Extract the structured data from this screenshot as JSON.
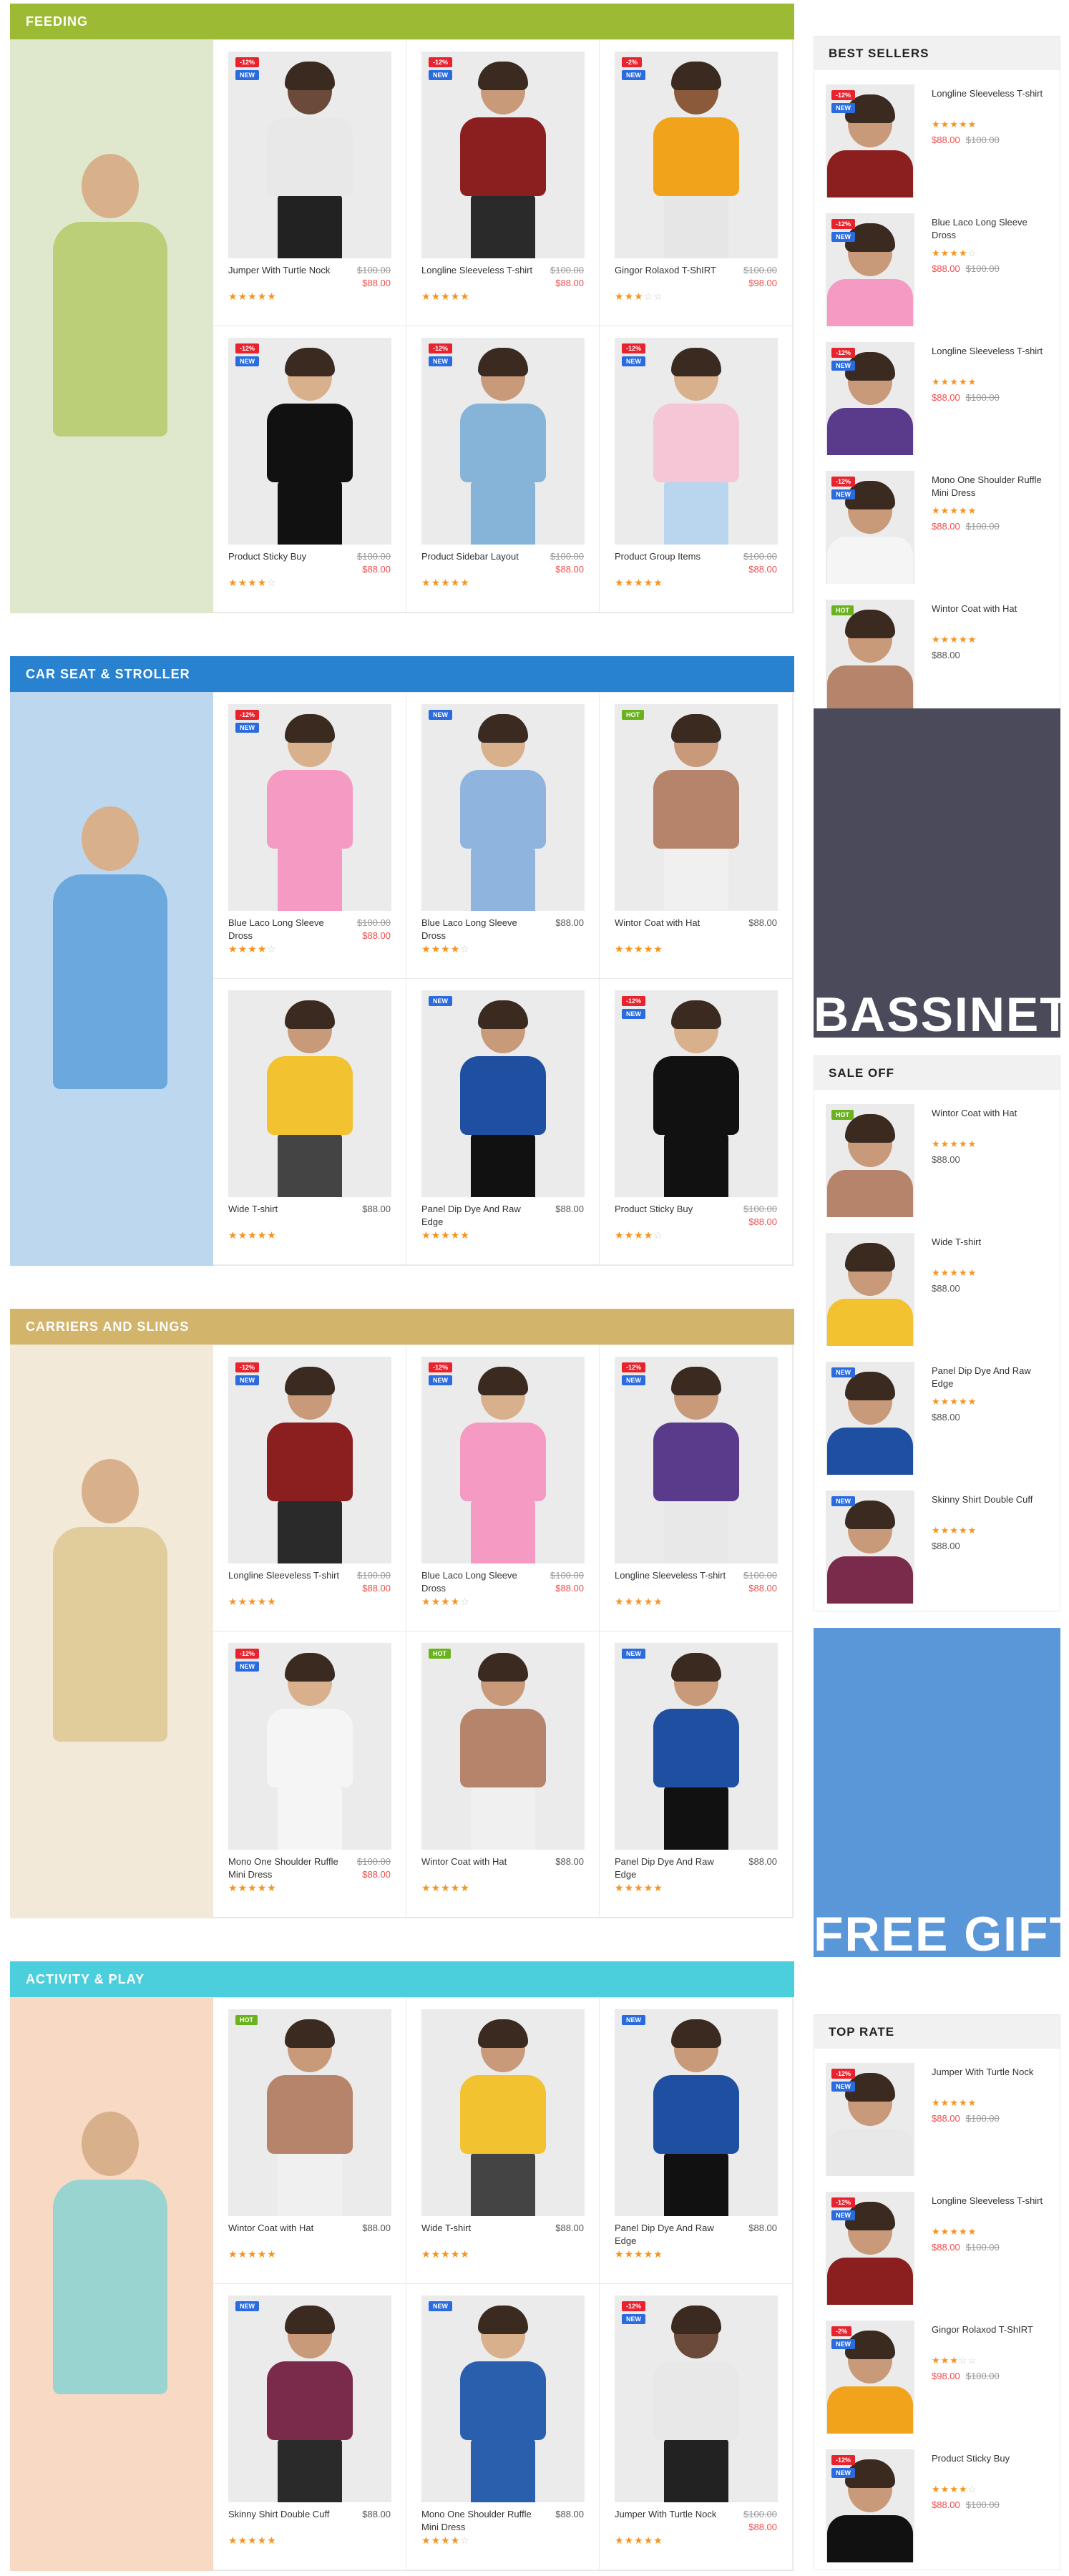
{
  "sections": [
    {
      "title": "FEEDING",
      "color": "#9cba33",
      "banner_bg": "#dfe8cd",
      "products": [
        {
          "name": "Jumper With Turtle Nock",
          "old": "$100.00",
          "price": "$88.00",
          "stars": 5,
          "badges": [
            "-12%",
            "NEW"
          ],
          "top": "#e8e8e8",
          "bottom": "#222222",
          "skin": "#6b4a3a"
        },
        {
          "name": "Longline Sleeveless T-shirt",
          "old": "$100.00",
          "price": "$88.00",
          "stars": 5,
          "badges": [
            "-12%",
            "NEW"
          ],
          "top": "#8b1f1f",
          "bottom": "#2a2a2a",
          "skin": "#c89a7a"
        },
        {
          "name": "Gingor Rolaxod T-ShIRT",
          "old": "$100.00",
          "price": "$98.00",
          "stars": 3,
          "badges": [
            "-2%",
            "NEW"
          ],
          "top": "#f2a31c",
          "bottom": "#e6e6e6",
          "skin": "#8a5a3a"
        },
        {
          "name": "Product Sticky Buy",
          "old": "$100.00",
          "price": "$88.00",
          "stars": 4,
          "badges": [
            "-12%",
            "NEW"
          ],
          "top": "#111111",
          "bottom": "#111111",
          "skin": "#d9b08c"
        },
        {
          "name": "Product Sidebar Layout",
          "old": "$100.00",
          "price": "$88.00",
          "stars": 5,
          "badges": [
            "-12%",
            "NEW"
          ],
          "top": "#86b4d8",
          "bottom": "#86b4d8",
          "skin": "#c89a7a"
        },
        {
          "name": "Product Group Items",
          "old": "$100.00",
          "price": "$88.00",
          "stars": 5,
          "badges": [
            "-12%",
            "NEW"
          ],
          "top": "#f5c6d6",
          "bottom": "#b9d6ee",
          "skin": "#d9b08c"
        }
      ]
    },
    {
      "title": "CAR SEAT & STROLLER",
      "color": "#2882d0",
      "banner_bg": "#bdd7ee",
      "products": [
        {
          "name": "Blue Laco Long Sleeve Dross",
          "old": "$100.00",
          "price": "$88.00",
          "stars": 4,
          "badges": [
            "-12%",
            "NEW"
          ],
          "top": "#f49ac3",
          "bottom": "#f49ac3",
          "skin": "#d9b08c"
        },
        {
          "name": "Blue Laco Long Sleeve Dross",
          "old": "",
          "price": "$88.00",
          "stars": 4,
          "badges": [
            "NEW"
          ],
          "top": "#8fb4dd",
          "bottom": "#8fb4dd",
          "skin": "#d9b08c"
        },
        {
          "name": "Wintor Coat with Hat",
          "old": "",
          "price": "$88.00",
          "stars": 5,
          "badges": [
            "HOT"
          ],
          "top": "#b5846a",
          "bottom": "#f0f0f0",
          "skin": "#c89a7a"
        },
        {
          "name": "Wide T-shirt",
          "old": "",
          "price": "$88.00",
          "stars": 5,
          "badges": [],
          "top": "#f2c230",
          "bottom": "#444444",
          "skin": "#c89a7a"
        },
        {
          "name": "Panel Dip Dye And Raw Edge",
          "old": "",
          "price": "$88.00",
          "stars": 5,
          "badges": [
            "NEW"
          ],
          "top": "#1f4fa0",
          "bottom": "#111111",
          "skin": "#c89a7a"
        },
        {
          "name": "Product Sticky Buy",
          "old": "$100.00",
          "price": "$88.00",
          "stars": 4,
          "badges": [
            "-12%",
            "NEW"
          ],
          "top": "#111111",
          "bottom": "#111111",
          "skin": "#d9b08c"
        }
      ]
    },
    {
      "title": "CARRIERS AND SLINGS",
      "color": "#d2b46a",
      "banner_bg": "#f3e9d8",
      "products": [
        {
          "name": "Longline Sleeveless T-shirt",
          "old": "$100.00",
          "price": "$88.00",
          "stars": 5,
          "badges": [
            "-12%",
            "NEW"
          ],
          "top": "#8b1f1f",
          "bottom": "#2a2a2a",
          "skin": "#c89a7a"
        },
        {
          "name": "Blue Laco Long Sleeve Dross",
          "old": "$100.00",
          "price": "$88.00",
          "stars": 4,
          "badges": [
            "-12%",
            "NEW"
          ],
          "top": "#f49ac3",
          "bottom": "#f49ac3",
          "skin": "#d9b08c"
        },
        {
          "name": "Longline Sleeveless T-shirt",
          "old": "$100.00",
          "price": "$88.00",
          "stars": 5,
          "badges": [
            "-12%",
            "NEW"
          ],
          "top": "#5a3a8a",
          "bottom": "#e8e8e8",
          "skin": "#c89a7a"
        },
        {
          "name": "Mono One Shoulder Ruffle Mini Dress",
          "old": "$100.00",
          "price": "$88.00",
          "stars": 5,
          "badges": [
            "-12%",
            "NEW"
          ],
          "top": "#f5f5f5",
          "bottom": "#f5f5f5",
          "skin": "#d9b08c"
        },
        {
          "name": "Wintor Coat with Hat",
          "old": "",
          "price": "$88.00",
          "stars": 5,
          "badges": [
            "HOT"
          ],
          "top": "#b5846a",
          "bottom": "#f0f0f0",
          "skin": "#c89a7a"
        },
        {
          "name": "Panel Dip Dye And Raw Edge",
          "old": "",
          "price": "$88.00",
          "stars": 5,
          "badges": [
            "NEW"
          ],
          "top": "#1f4fa0",
          "bottom": "#111111",
          "skin": "#c89a7a"
        }
      ]
    },
    {
      "title": "ACTIVITY & PLAY",
      "color": "#4ccfdc",
      "banner_bg": "#f7d9c4",
      "products": [
        {
          "name": "Wintor Coat with Hat",
          "old": "",
          "price": "$88.00",
          "stars": 5,
          "badges": [
            "HOT"
          ],
          "top": "#b5846a",
          "bottom": "#f0f0f0",
          "skin": "#c89a7a"
        },
        {
          "name": "Wide T-shirt",
          "old": "",
          "price": "$88.00",
          "stars": 5,
          "badges": [],
          "top": "#f2c230",
          "bottom": "#444444",
          "skin": "#c89a7a"
        },
        {
          "name": "Panel Dip Dye And Raw Edge",
          "old": "",
          "price": "$88.00",
          "stars": 5,
          "badges": [
            "NEW"
          ],
          "top": "#1f4fa0",
          "bottom": "#111111",
          "skin": "#c89a7a"
        },
        {
          "name": "Skinny Shirt Double Cuff",
          "old": "",
          "price": "$88.00",
          "stars": 5,
          "badges": [
            "NEW"
          ],
          "top": "#7a2a4a",
          "bottom": "#2a2a2a",
          "skin": "#c89a7a"
        },
        {
          "name": "Mono One Shoulder Ruffle Mini Dress",
          "old": "",
          "price": "$88.00",
          "stars": 4,
          "badges": [
            "NEW"
          ],
          "top": "#2a5fae",
          "bottom": "#2a5fae",
          "skin": "#d9b08c"
        },
        {
          "name": "Jumper With Turtle Nock",
          "old": "$100.00",
          "price": "$88.00",
          "stars": 5,
          "badges": [
            "-12%",
            "NEW"
          ],
          "top": "#e8e8e8",
          "bottom": "#222222",
          "skin": "#6b4a3a"
        }
      ]
    }
  ],
  "sidebar": {
    "best_sellers": {
      "title": "BEST SELLERS",
      "items": [
        {
          "name": "Longline Sleeveless T-shirt",
          "old": "$100.00",
          "price": "$88.00",
          "stars": 5,
          "badges": [
            "-12%",
            "NEW"
          ],
          "top": "#8b1f1f",
          "bottom": "#2a2a2a"
        },
        {
          "name": "Blue Laco Long Sleeve Dross",
          "old": "$100.00",
          "price": "$88.00",
          "stars": 4,
          "badges": [
            "-12%",
            "NEW"
          ],
          "top": "#f49ac3",
          "bottom": "#f49ac3"
        },
        {
          "name": "Longline Sleeveless T-shirt",
          "old": "$100.00",
          "price": "$88.00",
          "stars": 5,
          "badges": [
            "-12%",
            "NEW"
          ],
          "top": "#5a3a8a",
          "bottom": "#e8e8e8"
        },
        {
          "name": "Mono One Shoulder Ruffle Mini Dress",
          "old": "$100.00",
          "price": "$88.00",
          "stars": 5,
          "badges": [
            "-12%",
            "NEW"
          ],
          "top": "#f5f5f5",
          "bottom": "#f5f5f5"
        },
        {
          "name": "Wintor Coat with Hat",
          "old": "",
          "price": "$88.00",
          "stars": 5,
          "badges": [
            "HOT"
          ],
          "top": "#b5846a",
          "bottom": "#f0f0f0"
        }
      ]
    },
    "promo1": {
      "text": "BASSINET",
      "bg": "#4a4a5a"
    },
    "sale_off": {
      "title": "SALE OFF",
      "items": [
        {
          "name": "Wintor Coat with Hat",
          "old": "",
          "price": "$88.00",
          "stars": 5,
          "badges": [
            "HOT"
          ],
          "top": "#b5846a",
          "bottom": "#f0f0f0"
        },
        {
          "name": "Wide T-shirt",
          "old": "",
          "price": "$88.00",
          "stars": 5,
          "badges": [],
          "top": "#f2c230",
          "bottom": "#444444"
        },
        {
          "name": "Panel Dip Dye And Raw Edge",
          "old": "",
          "price": "$88.00",
          "stars": 5,
          "badges": [
            "NEW"
          ],
          "top": "#1f4fa0",
          "bottom": "#111111"
        },
        {
          "name": "Skinny Shirt Double Cuff",
          "old": "",
          "price": "$88.00",
          "stars": 5,
          "badges": [
            "NEW"
          ],
          "top": "#7a2a4a",
          "bottom": "#2a2a2a"
        }
      ]
    },
    "promo2": {
      "text": "FREE GIFT",
      "bg": "#5a97d8"
    },
    "top_rate": {
      "title": "TOP RATE",
      "items": [
        {
          "name": "Jumper With Turtle Nock",
          "old": "$100.00",
          "price": "$88.00",
          "stars": 5,
          "badges": [
            "-12%",
            "NEW"
          ],
          "top": "#e8e8e8",
          "bottom": "#222222"
        },
        {
          "name": "Longline Sleeveless T-shirt",
          "old": "$100.00",
          "price": "$88.00",
          "stars": 5,
          "badges": [
            "-12%",
            "NEW"
          ],
          "top": "#8b1f1f",
          "bottom": "#2a2a2a"
        },
        {
          "name": "Gingor Rolaxod T-ShIRT",
          "old": "$100.00",
          "price": "$98.00",
          "stars": 3,
          "badges": [
            "-2%",
            "NEW"
          ],
          "top": "#f2a31c",
          "bottom": "#e6e6e6"
        },
        {
          "name": "Product Sticky Buy",
          "old": "$100.00",
          "price": "$88.00",
          "stars": 4,
          "badges": [
            "-12%",
            "NEW"
          ],
          "top": "#111111",
          "bottom": "#111111"
        }
      ]
    }
  }
}
